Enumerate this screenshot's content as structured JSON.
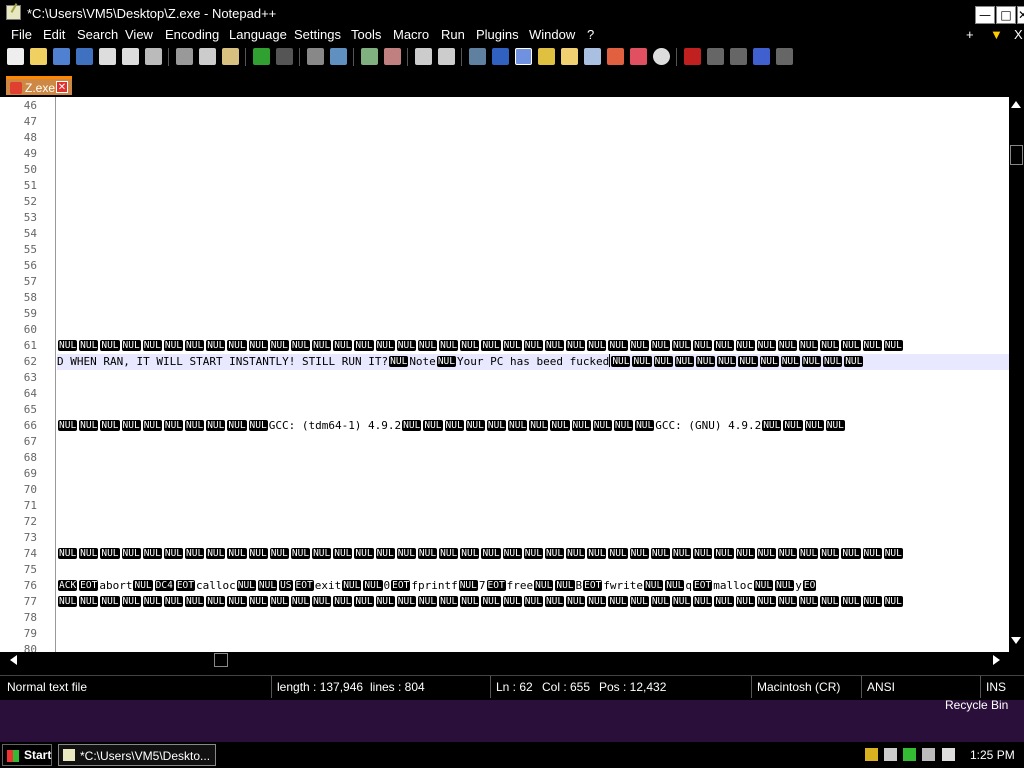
{
  "window": {
    "title": "*C:\\Users\\VM5\\Desktop\\Z.exe - Notepad++",
    "min_glyph": "—",
    "max_glyph": "□",
    "close_glyph": "✕"
  },
  "menu": {
    "items": [
      "File",
      "Edit",
      "Search",
      "View",
      "Encoding",
      "Language",
      "Settings",
      "Tools",
      "Macro",
      "Run",
      "Plugins",
      "Window",
      "?"
    ],
    "plus": "+",
    "arrow": "▼",
    "close": "X"
  },
  "toolbar_icons": [
    "new-file-icon",
    "open-file-icon",
    "save-icon",
    "save-all-icon",
    "close-icon",
    "close-all-icon",
    "print-icon",
    "cut-icon",
    "copy-icon",
    "paste-icon",
    "undo-icon",
    "redo-icon",
    "find-icon",
    "replace-icon",
    "zoom-in-icon",
    "zoom-out-icon",
    "sync-v-icon",
    "sync-h-icon",
    "word-wrap-icon",
    "show-all-chars-icon",
    "indent-guide-icon",
    "udl-icon",
    "doc-map-icon",
    "function-list-icon",
    "folder-workspace-icon",
    "monitor-icon",
    "record-macro-icon",
    "stop-record-icon",
    "play-macro-icon",
    "run-macro-icon",
    "save-macro-icon"
  ],
  "tab": {
    "label": "Z.exe",
    "close": "✕"
  },
  "editor": {
    "line_numbers": [
      "46",
      "47",
      "48",
      "49",
      "50",
      "51",
      "52",
      "53",
      "54",
      "55",
      "56",
      "57",
      "58",
      "59",
      "60",
      "61",
      "62",
      "63",
      "64",
      "65",
      "66",
      "67",
      "68",
      "69",
      "70",
      "71",
      "72",
      "73",
      "74",
      "75",
      "76",
      "77",
      "78",
      "79",
      "80"
    ],
    "line62_text": "D WHEN RAN, IT WILL START INSTANTLY! STILL RUN IT?",
    "line62_note": "Note",
    "line62_msg": "Your PC has beed fucked",
    "line66_gcc1": "GCC: (tdm64-1) 4.9.2",
    "line66_gcc2": "GCC: (GNU) 4.9.2",
    "line76_tokens": [
      "ACK",
      "EOT",
      "abort",
      "NUL",
      "DC4",
      "EOT",
      "calloc",
      "NUL",
      "NUL",
      "US",
      "EOT",
      "exit",
      "NUL",
      "NUL",
      "0",
      "EOT",
      "fprintf",
      "NUL",
      "7",
      "EOT",
      "free",
      "NUL",
      "NUL",
      "B",
      "EOT",
      "fwrite",
      "NUL",
      "NUL",
      "q",
      "EOT",
      "malloc",
      "NUL",
      "NUL",
      "y",
      "EO"
    ],
    "nul": "NUL"
  },
  "status": {
    "file_type": "Normal text file",
    "length": "length : 137,946",
    "lines": "lines : 804",
    "ln": "Ln : 62",
    "col": "Col : 655",
    "pos": "Pos : 12,432",
    "eol": "Macintosh (CR)",
    "encoding": "ANSI",
    "mode": "INS"
  },
  "desktop": {
    "recycle_bin": "Recycle Bin"
  },
  "taskbar": {
    "start": "Start",
    "task_label": "*C:\\Users\\VM5\\Deskto...",
    "clock": "1:25 PM"
  }
}
